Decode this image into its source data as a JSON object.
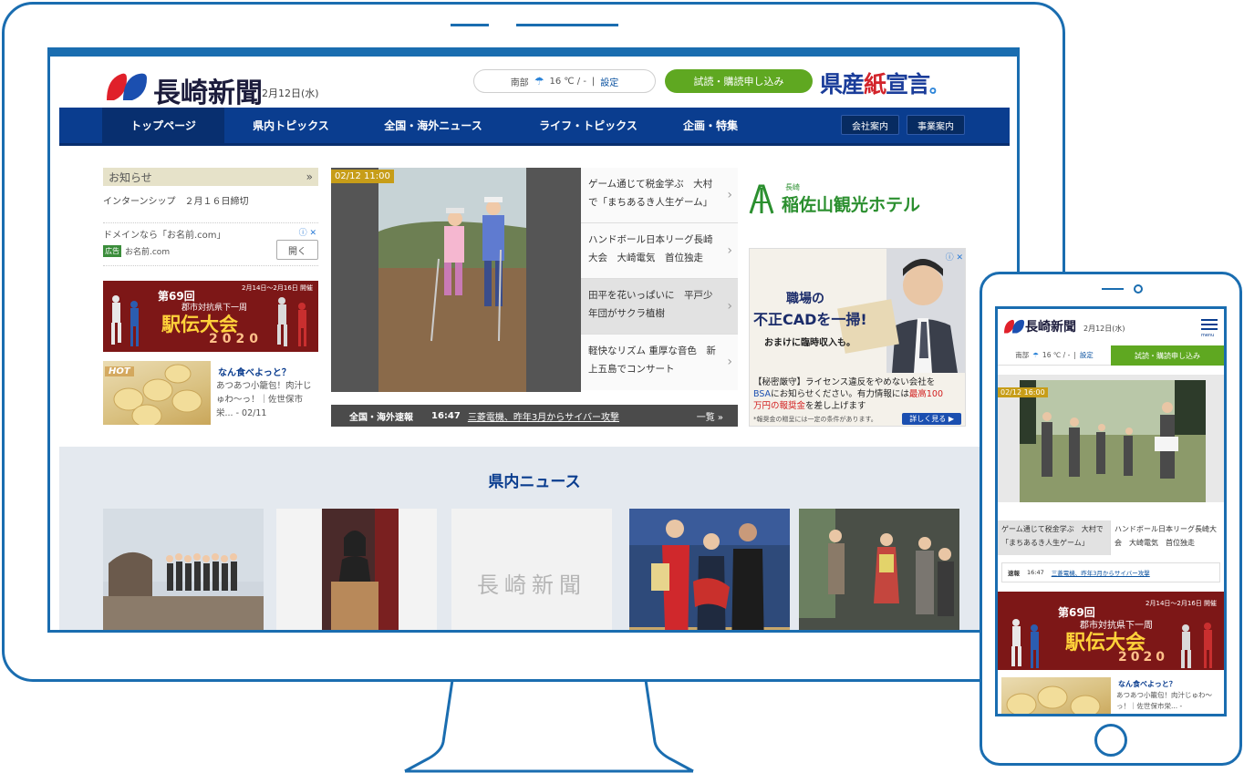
{
  "site": {
    "logo_text": "長崎新聞",
    "date": "2月12日(水)",
    "weather": {
      "area": "南部",
      "icon": "umbrella-icon",
      "temp": "16 ℃ / -",
      "separator": "|",
      "setting": "設定"
    },
    "trial_button": "試読・購読申し込み",
    "kensan": {
      "part1": "県産",
      "red": "紙",
      "part2": "宣言",
      "dot": "。"
    }
  },
  "nav": {
    "items": [
      {
        "label": "トップページ"
      },
      {
        "label": "県内トピックス"
      },
      {
        "label": "全国・海外ニュース"
      },
      {
        "label": "ライフ・トピックス"
      },
      {
        "label": "企画・特集"
      }
    ],
    "company": "会社案内",
    "business": "事業案内"
  },
  "notice": {
    "heading": "お知らせ",
    "more": "»",
    "item": "インターンシップ　２月１６日締切"
  },
  "domain_ad": {
    "line1": "ドメインなら「お名前.com」",
    "badge": "広告",
    "domain": "お名前.com",
    "open": "開く",
    "ad_choices": "ⓘ ✕"
  },
  "ekiden": {
    "date": "2月14日〜2月16日 開催",
    "num": "第69回",
    "sub": "郡市対抗県下一周",
    "title": "駅伝大会",
    "year": "2020"
  },
  "food": {
    "hot": "HOT",
    "title": "なん食べよっと？",
    "desc": "あつあつ小籠包！肉汁じゅわ〜っ！｜佐世保市栄... - 02/11",
    "phone_desc": "あつあつ小籠包！肉汁じゅわ〜っ！｜佐世保市栄... -"
  },
  "slider": {
    "time": "02/12 11:00",
    "items": [
      {
        "text": "ゲーム通じて税金学ぶ　大村で「まちあるき人生ゲーム」"
      },
      {
        "text": "ハンドボール日本リーグ長崎大会　大崎電気　首位独走"
      },
      {
        "text": "田平を花いっぱいに　平戸少年団がサクラ植樹"
      },
      {
        "text": "軽快なリズム 重厚な音色　新上五島でコンサート"
      }
    ]
  },
  "breaking": {
    "label": "全国・海外速報",
    "time": "16:47",
    "headline": "三菱電機、昨年3月からサイバー攻撃",
    "more": "一覧 »"
  },
  "hotel": {
    "small": "長崎",
    "name": "稲佐山観光ホテル"
  },
  "bsa_ad": {
    "h1": "職場の",
    "h2": "不正CADを一掃!",
    "h3": "おまけに臨時収入も。",
    "body1": "【秘密厳守】ライセンス違反をやめない会社を",
    "body_blue": "BSA",
    "body2": "にお知らせください。有力情報には",
    "body_red": "最高100万円の報奨金",
    "body3": "を差し上げます",
    "note": "*報奨金の贈呈には一定の条件があります。",
    "button": "詳しく見る ▶",
    "ai": "ⓘ ✕"
  },
  "kennai": {
    "title": "県内ニュース",
    "placeholder_logo": "長崎新聞"
  },
  "phone": {
    "menu": "menu",
    "time": "02/12 16:00",
    "items": [
      {
        "text": "ゲーム通じて税金学ぶ　大村で「まちあるき人生ゲーム」"
      },
      {
        "text": "ハンドボール日本リーグ長崎大会　大崎電気　首位独走"
      }
    ],
    "break_label": "速報"
  },
  "colors": {
    "brand_blue": "#0a3d8f",
    "frame_blue": "#1a6db0",
    "green": "#5fa821",
    "time_badge": "#c79d18",
    "ekiden_red": "#7d1717"
  }
}
